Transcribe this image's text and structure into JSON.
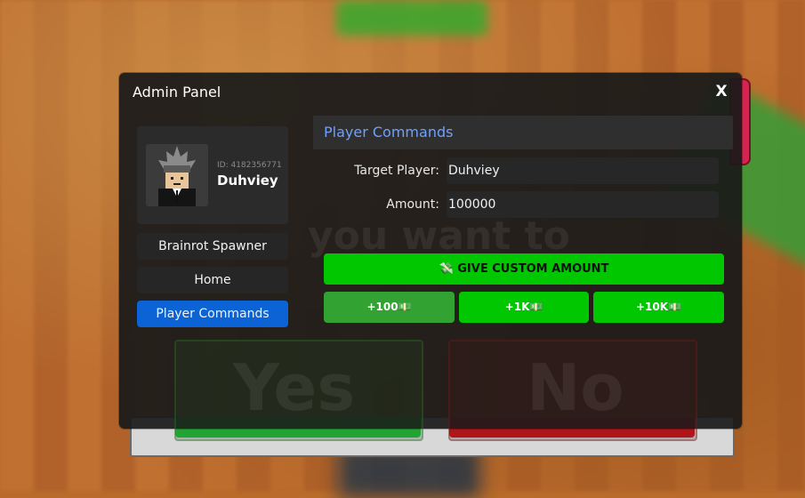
{
  "panel": {
    "title": "Admin Panel",
    "close_label": "X"
  },
  "profile": {
    "user_id": "ID: 4182356771",
    "username": "Duhviey"
  },
  "sidebar": {
    "items": [
      {
        "label": "Brainrot Spawner",
        "active": false
      },
      {
        "label": "Home",
        "active": false
      },
      {
        "label": "Player Commands",
        "active": true
      }
    ]
  },
  "main": {
    "section_title": "Player Commands",
    "target_player_label": "Target Player:",
    "target_player_value": "Duhviey",
    "amount_label": "Amount:",
    "amount_value": "100000",
    "give_button_icon": "money-wings-icon",
    "give_button_label": "GIVE CUSTOM AMOUNT",
    "amount_buttons": [
      {
        "label": "+100",
        "icon": "money-bag-icon"
      },
      {
        "label": "+1K",
        "icon": "money-bag-icon"
      },
      {
        "label": "+10K",
        "icon": "money-bag-icon"
      }
    ]
  },
  "background": {
    "ghost_yes": "Yes",
    "ghost_no": "No",
    "ghost_text": "you want to"
  },
  "colors": {
    "accent_blue": "#0b63d6",
    "section_title": "#6ea0ff",
    "green_button": "#00c700"
  }
}
